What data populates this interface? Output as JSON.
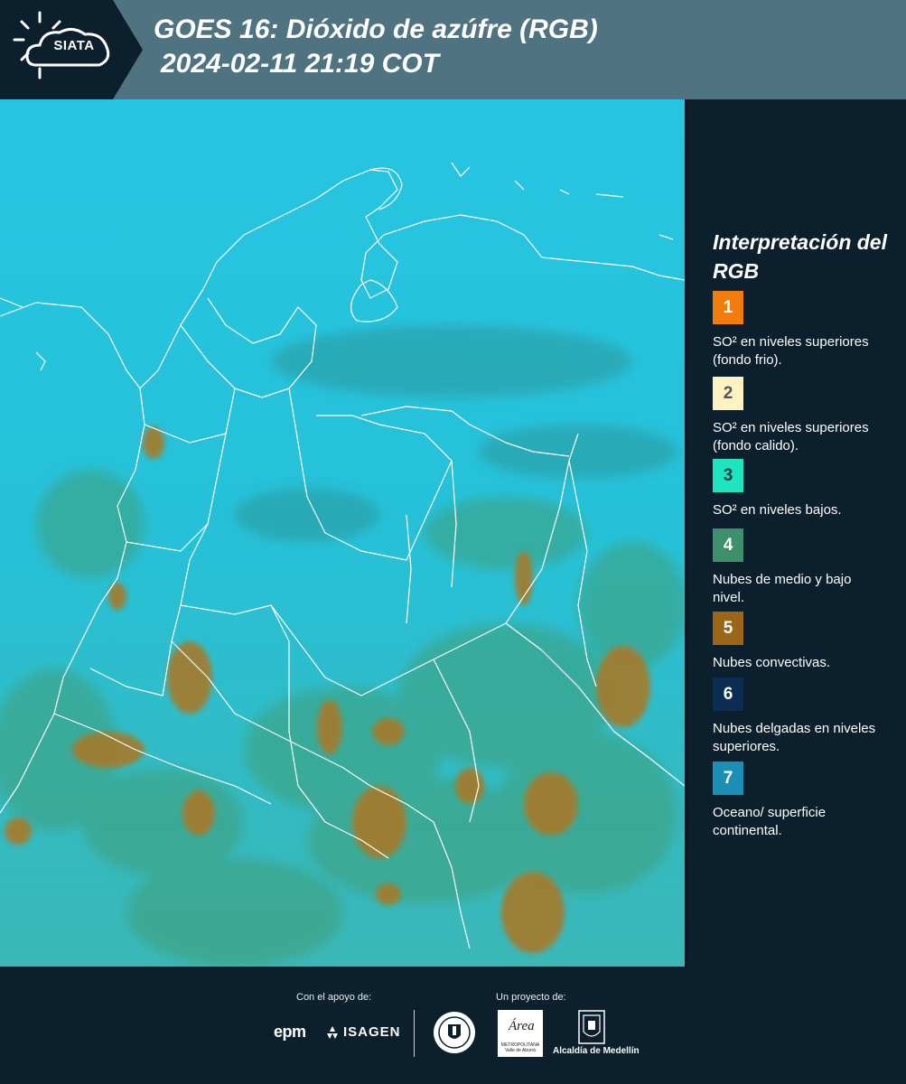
{
  "header": {
    "logo_text": "SIATA",
    "title_line1": "GOES 16: Dióxido de azúfre (RGB)",
    "title_line2": "2024-02-11 21:19 COT",
    "background_color": "#4f7380",
    "logo_band_color": "#0c1f2c"
  },
  "legend": {
    "title": "Interpretación del RGB",
    "items": [
      {
        "number": "1",
        "color": "#f27d0c",
        "text_color": "#ffffff",
        "description": "SO² en niveles superiores (fondo frio)."
      },
      {
        "number": "2",
        "color": "#fdf3c2",
        "text_color": "#555555",
        "description": "SO² en niveles superiores (fondo calido)."
      },
      {
        "number": "3",
        "color": "#1ee4c0",
        "text_color": "#0b3a44",
        "description": "SO² en niveles bajos."
      },
      {
        "number": "4",
        "color": "#3e8f6c",
        "text_color": "#ffffff",
        "description": "Nubes de medio y bajo nivel."
      },
      {
        "number": "5",
        "color": "#9b6618",
        "text_color": "#ffffff",
        "description": "Nubes convectivas."
      },
      {
        "number": "6",
        "color": "#0d2c52",
        "text_color": "#ffffff",
        "description": "Nubes delgadas en niveles superiores."
      },
      {
        "number": "7",
        "color": "#1b8fb6",
        "text_color": "#ffffff",
        "description": "Oceano/ superficie continental."
      }
    ]
  },
  "footer": {
    "support_label": "Con el apoyo de:",
    "project_label": "Un proyecto de:",
    "epm": "epm",
    "isagen": "ISAGEN",
    "area": "Área",
    "area_caption": "METROPOLITANA Valle de Aburrá",
    "alcaldia": "Alcaldía de Medellín"
  },
  "map": {
    "base_color": "#29c6df",
    "convective_color": "#a57a2a",
    "border_color": "#ffffff"
  }
}
